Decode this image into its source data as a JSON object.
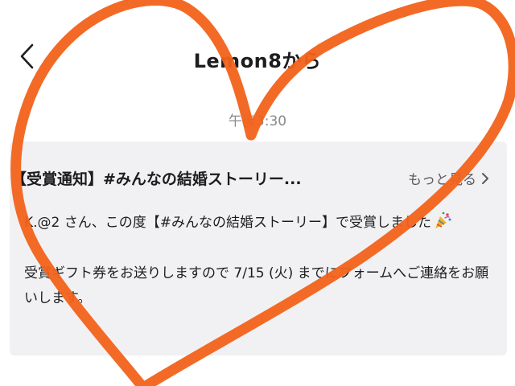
{
  "header": {
    "title": "Lemon8から",
    "back_icon": "chevron-left-icon"
  },
  "message": {
    "timestamp": "午後3:30",
    "title": "【受賞通知】#みんなの結婚ストーリー...",
    "more_label": "もっと見る",
    "more_icon": "chevron-right-icon",
    "body_line1": "K.@2 さん、この度【#みんなの結婚ストーリー】で受賞しました",
    "party_icon": "party-popper-icon",
    "body_line2": "受賞ギフト券をお送りしますので 7/15 (火) までにフォームへご連絡をお願いします。"
  },
  "annotation": {
    "shape": "heart-scribble",
    "color": "#f2621a"
  }
}
